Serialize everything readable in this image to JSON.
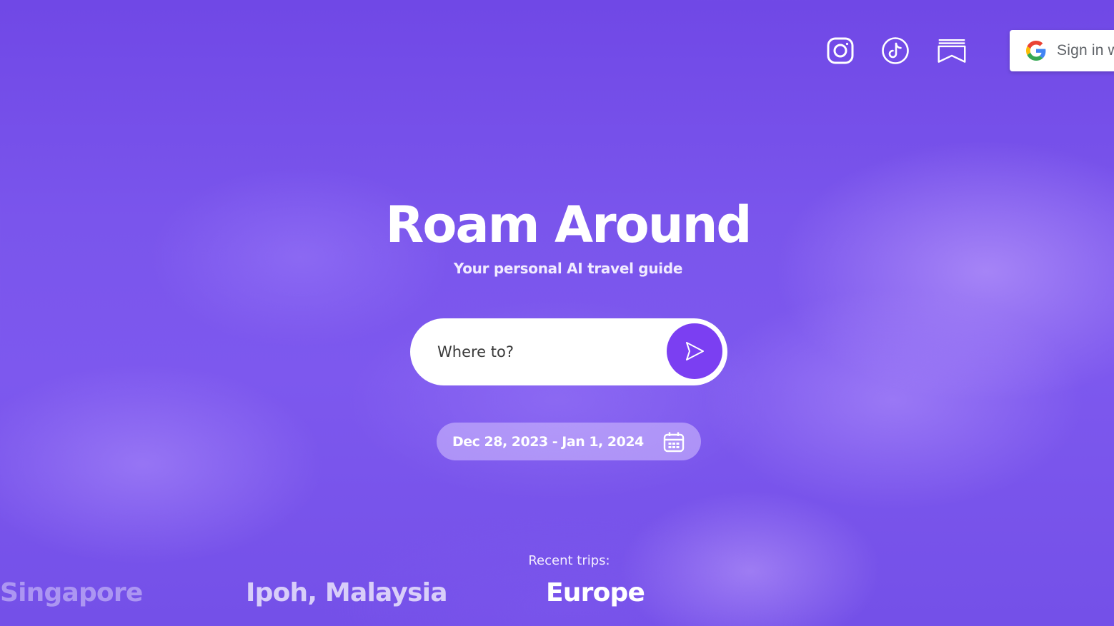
{
  "header": {
    "icons": [
      "instagram-icon",
      "tiktok-icon",
      "bookmark-icon"
    ],
    "signin": {
      "label": "Sign in w",
      "icon": "google-icon"
    }
  },
  "hero": {
    "title": "Roam Around",
    "subtitle": "Your personal AI travel guide"
  },
  "search": {
    "placeholder": "Where to?",
    "value": "",
    "submit_icon": "send-arrow-icon"
  },
  "dates": {
    "range": "Dec 28, 2023 - Jan 1, 2024",
    "icon": "calendar-icon"
  },
  "recent": {
    "label": "Recent trips:",
    "trips": [
      "Singapore",
      "Ipoh, Malaysia",
      "Europe"
    ]
  },
  "colors": {
    "background": "#7651ea",
    "accent": "#7b3ff2",
    "white": "#ffffff"
  }
}
